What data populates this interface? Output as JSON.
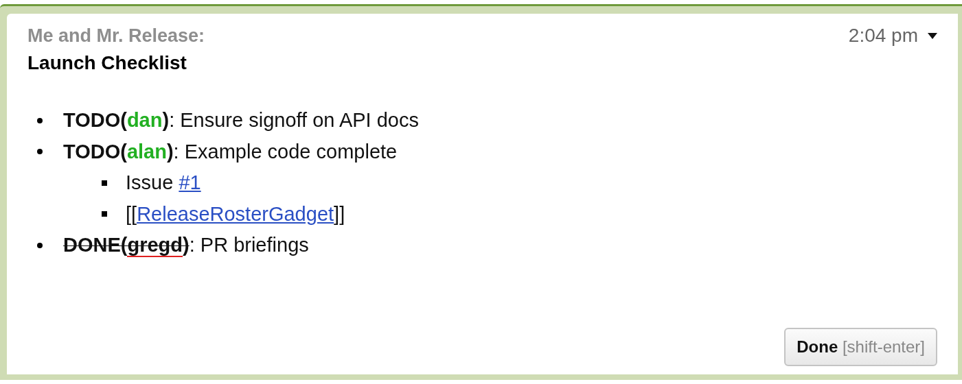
{
  "header": {
    "participants": "Me and Mr. Release:",
    "time": "2:04 pm",
    "title": "Launch Checklist"
  },
  "items": [
    {
      "kind": "task",
      "prefix": "TODO(",
      "owner": "dan",
      "suffix": ")",
      "text": ": Ensure signoff on API docs",
      "done": false,
      "misspelled": false
    },
    {
      "kind": "task",
      "prefix": "TODO(",
      "owner": "alan",
      "suffix": ")",
      "text": ": Example code complete",
      "done": false,
      "misspelled": false,
      "children": [
        {
          "kind": "link",
          "before": "Issue ",
          "link": "#1"
        },
        {
          "kind": "link",
          "before": "[[",
          "link": "ReleaseRosterGadget",
          "after": "]]"
        }
      ]
    },
    {
      "kind": "task",
      "prefix": "DONE(",
      "owner": "gregd",
      "suffix": ")",
      "text": ": PR briefings",
      "done": true,
      "misspelled": true
    }
  ],
  "button": {
    "label": "Done",
    "hint": "[shift-enter]"
  }
}
